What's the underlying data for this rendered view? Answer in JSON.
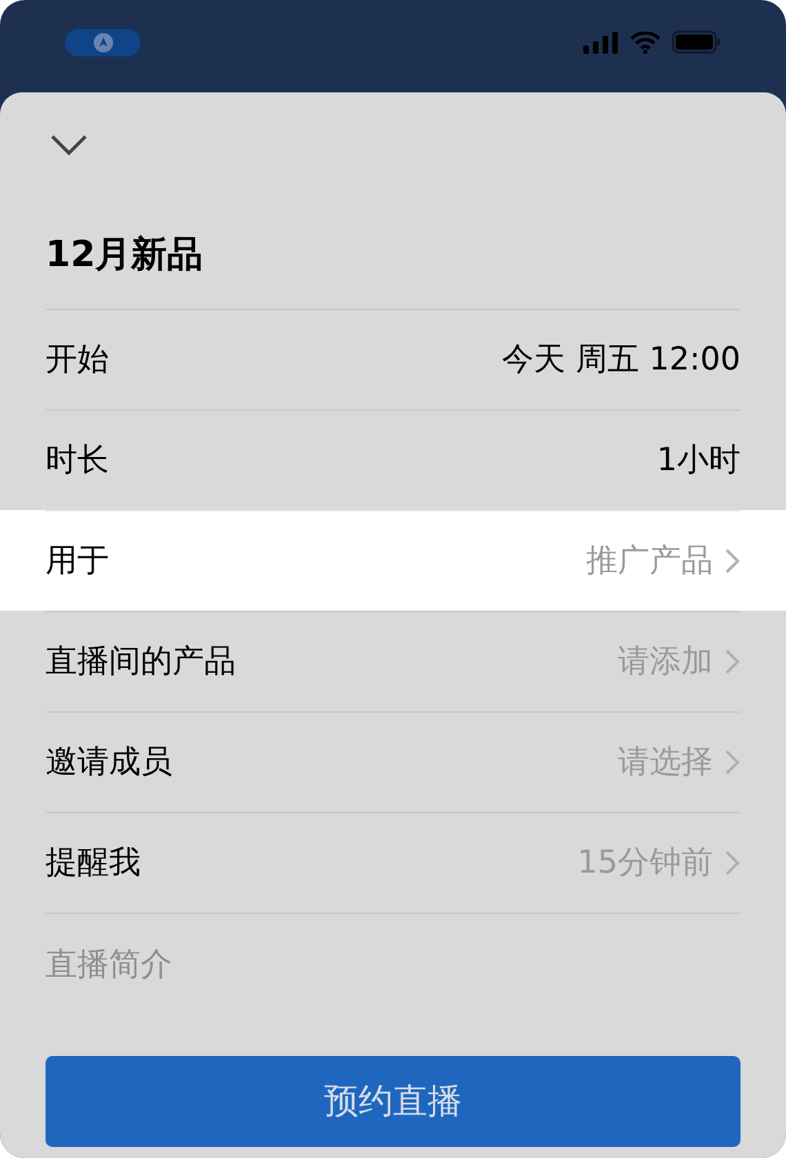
{
  "title": "12月新品",
  "rows": [
    {
      "label": "开始",
      "value": "今天 周五 12:00",
      "kind": "value",
      "highlighted": false
    },
    {
      "label": "时长",
      "value": "1小时",
      "kind": "value",
      "highlighted": false
    },
    {
      "label": "用于",
      "value": "推广产品",
      "kind": "link",
      "highlighted": true
    },
    {
      "label": "直播间的产品",
      "value": "请添加",
      "kind": "link",
      "highlighted": false
    },
    {
      "label": "邀请成员",
      "value": "请选择",
      "kind": "link",
      "highlighted": false
    },
    {
      "label": "提醒我",
      "value": "15分钟前",
      "kind": "link",
      "highlighted": false
    }
  ],
  "description": {
    "placeholder": "直播简介"
  },
  "submit_button": "预约直播"
}
